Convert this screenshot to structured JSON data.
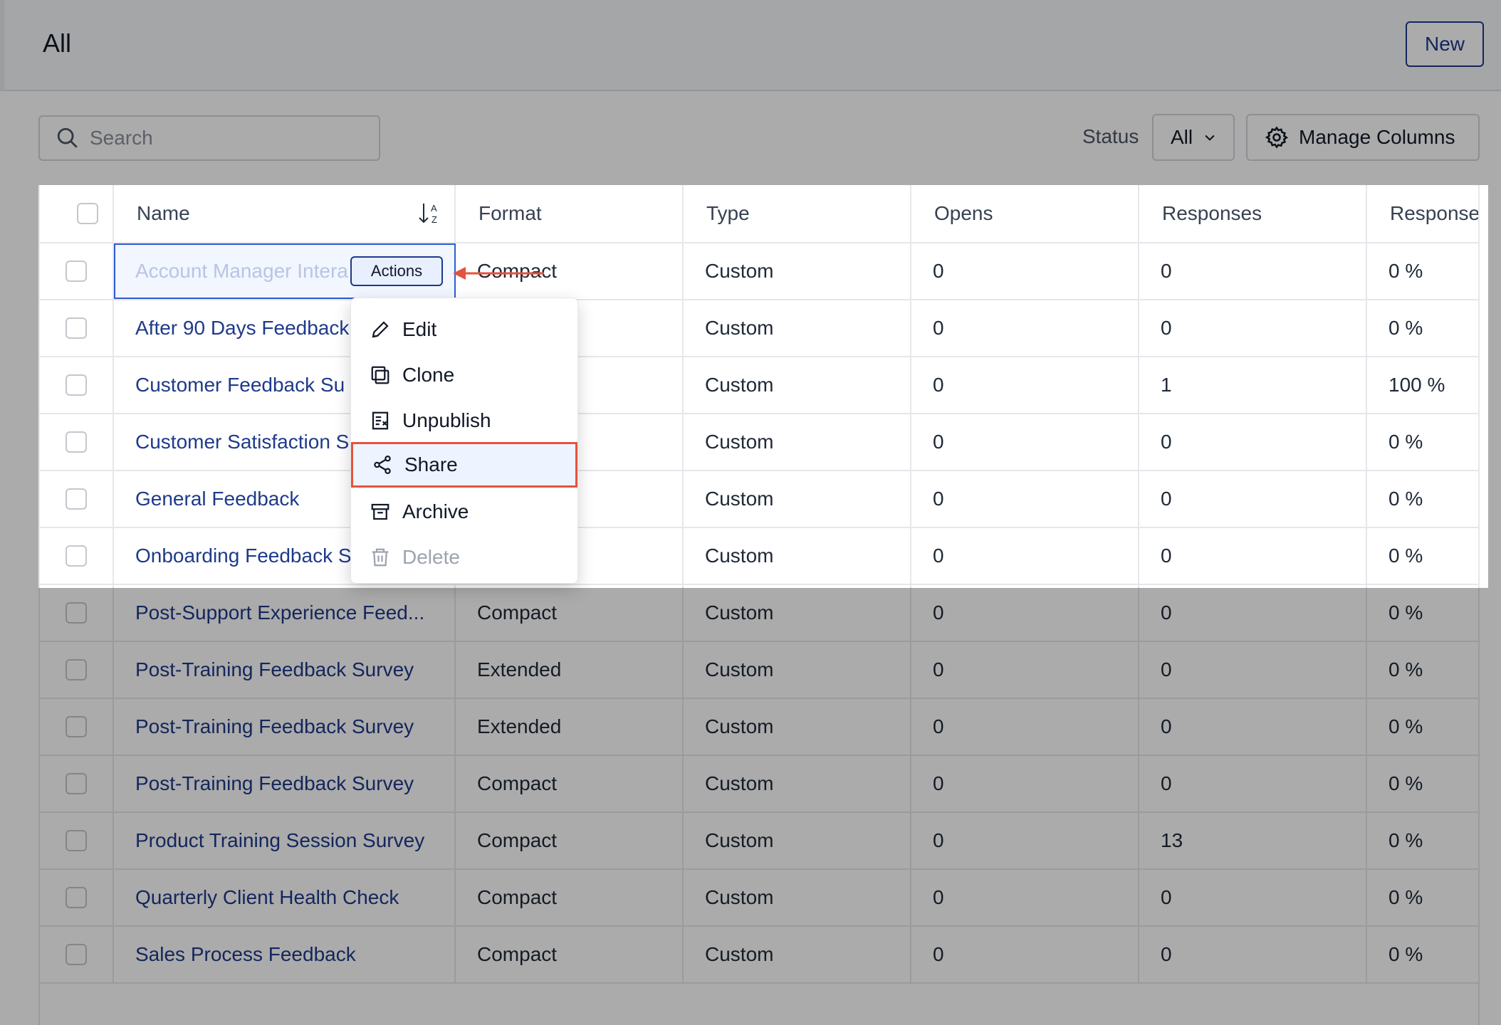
{
  "header": {
    "title": "All",
    "new_label": "New"
  },
  "toolbar": {
    "search_placeholder": "Search",
    "status_label": "Status",
    "status_value": "All",
    "manage_columns_label": "Manage Columns"
  },
  "table": {
    "columns": [
      "Name",
      "Format",
      "Type",
      "Opens",
      "Responses",
      "Response"
    ],
    "rows": [
      {
        "name": "Account Manager Intera",
        "format": "Compact",
        "type": "Custom",
        "opens": "0",
        "responses": "0",
        "rate": "0 %"
      },
      {
        "name": "After 90 Days Feedback",
        "format": "",
        "type": "Custom",
        "opens": "0",
        "responses": "0",
        "rate": "0 %"
      },
      {
        "name": "Customer Feedback Su",
        "format": "",
        "type": "Custom",
        "opens": "0",
        "responses": "1",
        "rate": "100 %"
      },
      {
        "name": "Customer Satisfaction S",
        "format": "",
        "type": "Custom",
        "opens": "0",
        "responses": "0",
        "rate": "0 %"
      },
      {
        "name": "General Feedback",
        "format": "",
        "type": "Custom",
        "opens": "0",
        "responses": "0",
        "rate": "0 %"
      },
      {
        "name": "Onboarding Feedback S",
        "format": "",
        "type": "Custom",
        "opens": "0",
        "responses": "0",
        "rate": "0 %"
      },
      {
        "name": "Post-Support Experience Feed...",
        "format": "Compact",
        "type": "Custom",
        "opens": "0",
        "responses": "0",
        "rate": "0 %"
      },
      {
        "name": "Post-Training Feedback Survey",
        "format": "Extended",
        "type": "Custom",
        "opens": "0",
        "responses": "0",
        "rate": "0 %"
      },
      {
        "name": "Post-Training Feedback Survey",
        "format": "Extended",
        "type": "Custom",
        "opens": "0",
        "responses": "0",
        "rate": "0 %"
      },
      {
        "name": "Post-Training Feedback Survey",
        "format": "Compact",
        "type": "Custom",
        "opens": "0",
        "responses": "0",
        "rate": "0 %"
      },
      {
        "name": "Product Training Session Survey",
        "format": "Compact",
        "type": "Custom",
        "opens": "0",
        "responses": "13",
        "rate": "0 %"
      },
      {
        "name": "Quarterly Client Health Check",
        "format": "Compact",
        "type": "Custom",
        "opens": "0",
        "responses": "0",
        "rate": "0 %"
      },
      {
        "name": "Sales Process Feedback",
        "format": "Compact",
        "type": "Custom",
        "opens": "0",
        "responses": "0",
        "rate": "0 %"
      }
    ]
  },
  "actions_label": "Actions",
  "menu": {
    "items": [
      {
        "label": "Edit",
        "icon": "pencil-icon"
      },
      {
        "label": "Clone",
        "icon": "clone-icon"
      },
      {
        "label": "Unpublish",
        "icon": "unpublish-icon"
      },
      {
        "label": "Share",
        "icon": "share-icon"
      },
      {
        "label": "Archive",
        "icon": "archive-icon"
      },
      {
        "label": "Delete",
        "icon": "trash-icon"
      }
    ]
  },
  "colors": {
    "link": "#1e3a8a",
    "accent": "#1d3a8a",
    "highlight_border": "#e5533d"
  }
}
